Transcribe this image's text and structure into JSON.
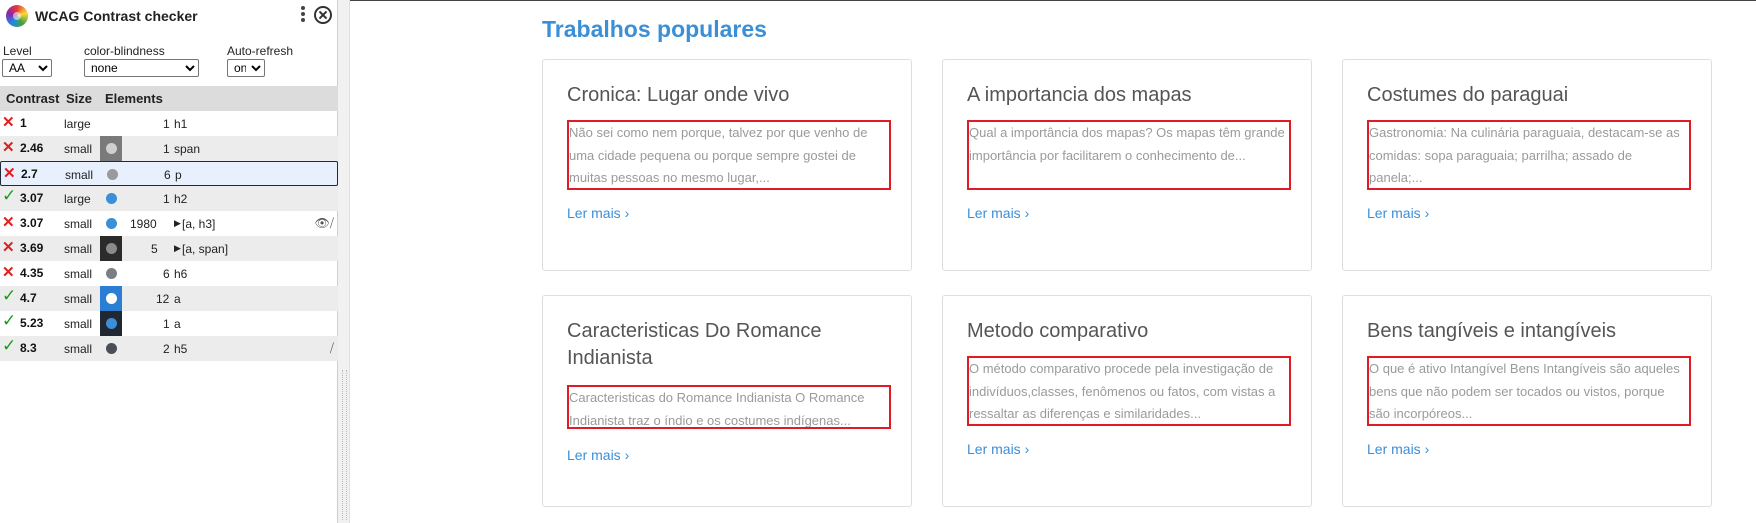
{
  "panel": {
    "title": "WCAG Contrast checker",
    "controls": {
      "level_label": "Level",
      "level_value": "AA",
      "colorblind_label": "color-blindness",
      "colorblind_value": "none",
      "autorefresh_label": "Auto-refresh",
      "autorefresh_value": "on"
    },
    "columns": {
      "contrast": "Contrast",
      "size": "Size",
      "elements": "Elements"
    },
    "rows": [
      {
        "status": "fail",
        "ratio": "1",
        "size": "large",
        "count": "1",
        "elements": "h1",
        "swatch": "none",
        "bg": "none",
        "expand": false,
        "icons": ""
      },
      {
        "status": "fail",
        "ratio": "2.46",
        "size": "small",
        "count": "1",
        "elements": "span",
        "swatch": "#cfcfcf",
        "bg": "#7a7a7a",
        "expand": false,
        "icons": ""
      },
      {
        "status": "fail",
        "ratio": "2.7",
        "size": "small",
        "count": "6",
        "elements": "p",
        "swatch": "#9a9a9a",
        "bg": "none",
        "expand": false,
        "icons": ""
      },
      {
        "status": "pass",
        "ratio": "3.07",
        "size": "large",
        "count": "1",
        "elements": "h2",
        "swatch": "#3b8fd6",
        "bg": "none",
        "expand": false,
        "icons": ""
      },
      {
        "status": "fail",
        "ratio": "3.07",
        "size": "small",
        "count": "1980",
        "elements": "[a, h3]",
        "swatch": "#3b8fd6",
        "bg": "none",
        "expand": true,
        "icons": "👁⧸"
      },
      {
        "status": "fail",
        "ratio": "3.69",
        "size": "small",
        "count": "5",
        "elements": "[a, span]",
        "swatch": "#8a8a8a",
        "bg": "#2b2b2b",
        "expand": true,
        "icons": ""
      },
      {
        "status": "fail",
        "ratio": "4.35",
        "size": "small",
        "count": "6",
        "elements": "h6",
        "swatch": "#7b7f85",
        "bg": "none",
        "expand": false,
        "icons": ""
      },
      {
        "status": "pass",
        "ratio": "4.7",
        "size": "small",
        "count": "12",
        "elements": "a",
        "swatch": "#ffffff",
        "bg": "#2a7ed3",
        "expand": false,
        "icons": ""
      },
      {
        "status": "pass",
        "ratio": "5.23",
        "size": "small",
        "count": "1",
        "elements": "a",
        "swatch": "#3b8fd6",
        "bg": "#222831",
        "expand": false,
        "icons": ""
      },
      {
        "status": "pass",
        "ratio": "8.3",
        "size": "small",
        "count": "2",
        "elements": "h5",
        "swatch": "#4a4f57",
        "bg": "none",
        "expand": false,
        "icons": "⧸"
      }
    ]
  },
  "page": {
    "section_title": "Trabalhos populares",
    "cards": [
      {
        "title": "Cronica: Lugar onde vivo",
        "text": "Não sei como nem porque, talvez por que venho de uma cidade pequena ou porque sempre gostei de muitas pessoas no mesmo lugar,...",
        "link": "Ler mais ›"
      },
      {
        "title": "A importancia dos mapas",
        "text": "Qual a importância dos mapas? Os mapas têm grande importância por facilitarem o conhecimento de...",
        "link": "Ler mais ›"
      },
      {
        "title": "Costumes do paraguai",
        "text": "Gastronomia: Na culinária paraguaia, destacam-se as comidas: sopa paraguaia; parrilha; assado de panela;...",
        "link": "Ler mais ›"
      },
      {
        "title": "Caracteristicas Do Romance Indianista",
        "text": "Caracteristicas do Romance Indianista O Romance Indianista traz o índio e os costumes indígenas...",
        "link": "Ler mais ›"
      },
      {
        "title": "Metodo comparativo",
        "text": "O método comparativo procede pela investigação de indivíduos,classes, fenômenos ou fatos, com vistas a ressaltar as diferenças e similaridades...",
        "link": "Ler mais ›"
      },
      {
        "title": "Bens tangíveis e intangíveis",
        "text": "O que é ativo Intangível Bens Intangíveis são aqueles bens que não podem ser tocados ou vistos, porque são incorpóreos...",
        "link": "Ler mais ›"
      }
    ]
  }
}
